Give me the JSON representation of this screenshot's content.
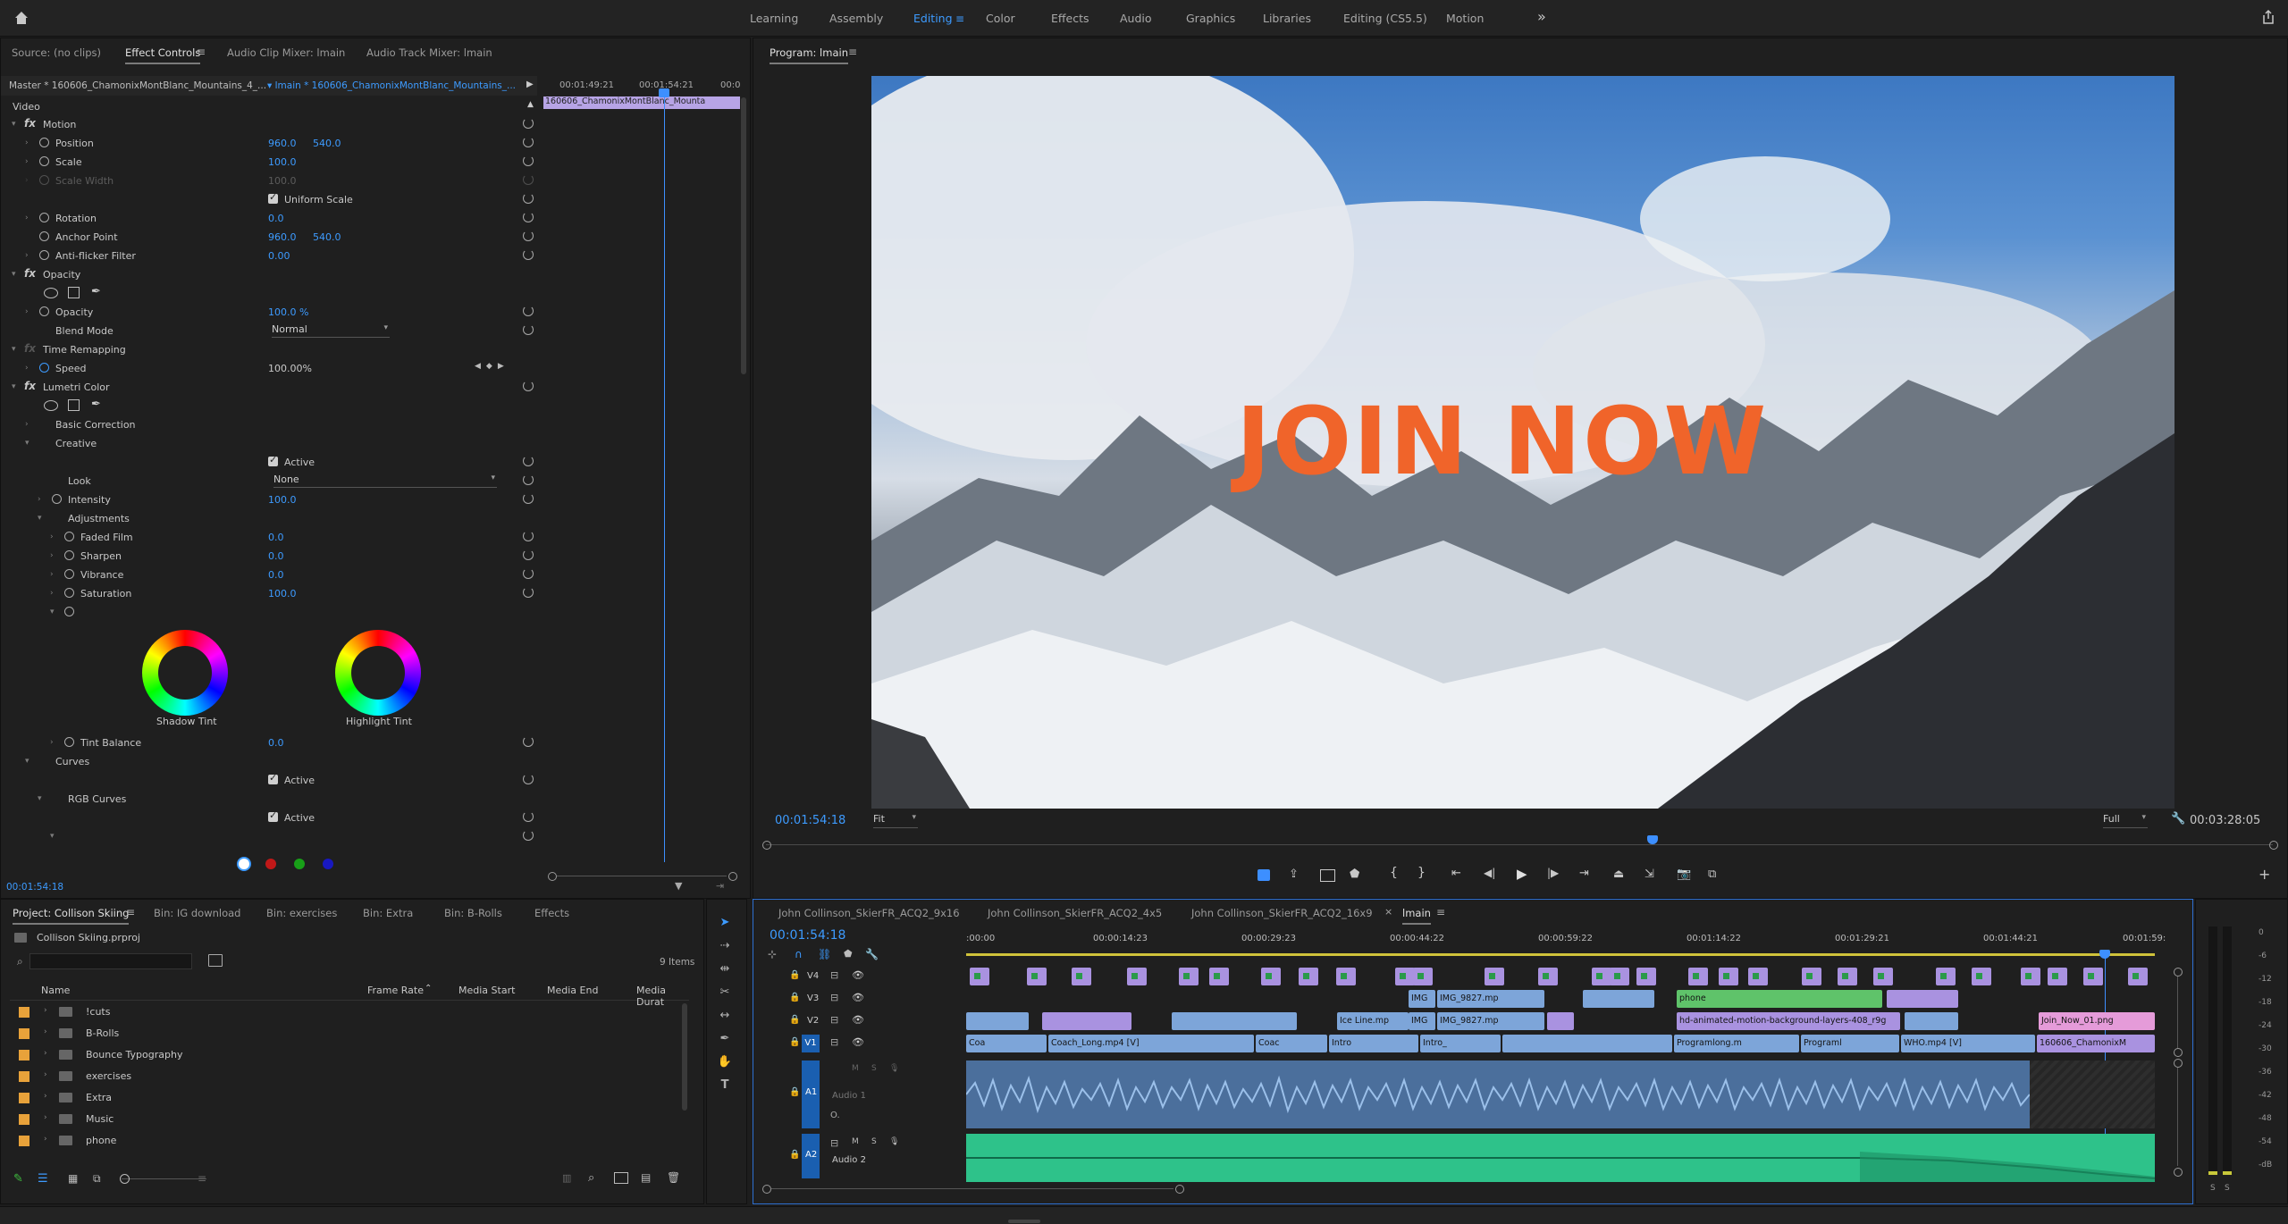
{
  "workspaces": [
    "Learning",
    "Assembly",
    "Editing",
    "Color",
    "Effects",
    "Audio",
    "Graphics",
    "Libraries",
    "Editing (CS5.5)",
    "Motion"
  ],
  "active_workspace": "Editing",
  "source_tabs": {
    "source": "Source: (no clips)",
    "effect_controls": "Effect Controls",
    "audio_clip_mixer": "Audio Clip Mixer: lmain",
    "audio_track_mixer": "Audio Track Mixer: lmain"
  },
  "effect_controls": {
    "master_clip": "Master * 160606_ChamonixMontBlanc_Mountains_4_...",
    "sequence_clip": "lmain * 160606_ChamonixMontBlanc_Mountains_...",
    "timecode_left": "00:01:49:21",
    "timecode_mid": "00:01:54:21",
    "timecode_right": "00:0",
    "clip_name": "160606_ChamonixMontBlanc_Mounta",
    "section_video": "Video",
    "current_time": "00:01:54:18",
    "rows": {
      "motion": "Motion",
      "position": "Position",
      "position_x": "960.0",
      "position_y": "540.0",
      "scale": "Scale",
      "scale_v": "100.0",
      "scale_width": "Scale Width",
      "scale_width_v": "100.0",
      "uniform_scale": "Uniform Scale",
      "rotation": "Rotation",
      "rotation_v": "0.0",
      "anchor": "Anchor Point",
      "anchor_x": "960.0",
      "anchor_y": "540.0",
      "antiflicker": "Anti-flicker Filter",
      "antiflicker_v": "0.00",
      "opacity_group": "Opacity",
      "opacity": "Opacity",
      "opacity_v": "100.0 %",
      "blend": "Blend Mode",
      "blend_v": "Normal",
      "time_remap": "Time Remapping",
      "speed": "Speed",
      "speed_v": "100.00%",
      "lumetri": "Lumetri Color",
      "basic": "Basic Correction",
      "creative": "Creative",
      "active": "Active",
      "look": "Look",
      "look_v": "None",
      "intensity": "Intensity",
      "intensity_v": "100.0",
      "adjustments": "Adjustments",
      "faded": "Faded Film",
      "faded_v": "0.0",
      "sharpen": "Sharpen",
      "sharpen_v": "0.0",
      "vibrance": "Vibrance",
      "vibrance_v": "0.0",
      "saturation": "Saturation",
      "saturation_v": "100.0",
      "shadow_tint": "Shadow Tint",
      "highlight_tint": "Highlight Tint",
      "tint_balance": "Tint Balance",
      "tint_balance_v": "0.0",
      "curves": "Curves",
      "rgb_curves": "RGB Curves"
    }
  },
  "program": {
    "title": "Program: lmain",
    "overlay_text": "JOIN NOW",
    "timecode": "00:01:54:18",
    "fit": "Fit",
    "quality": "Full",
    "duration": "00:03:28:05"
  },
  "project": {
    "tabs": [
      "Project: Collison Skiing",
      "Bin: IG download",
      "Bin: exercises",
      "Bin: Extra",
      "Bin: B-Rolls",
      "Effects"
    ],
    "file": "Collison Skiing.prproj",
    "items_count": "9 Items",
    "columns": [
      "Name",
      "Frame Rate",
      "Media Start",
      "Media End",
      "Media Durat"
    ],
    "items": [
      "!cuts",
      "B-Rolls",
      "Bounce Typography",
      "exercises",
      "Extra",
      "Music",
      "phone"
    ]
  },
  "timeline": {
    "tabs": [
      "John Collinson_SkierFR_ACQ2_9x16",
      "John Collinson_SkierFR_ACQ2_4x5",
      "John Collinson_SkierFR_ACQ2_16x9",
      "lmain"
    ],
    "timecode": "00:01:54:18",
    "ruler": [
      ":00:00",
      "00:00:14:23",
      "00:00:29:23",
      "00:00:44:22",
      "00:00:59:22",
      "00:01:14:22",
      "00:01:29:21",
      "00:01:44:21",
      "00:01:59:"
    ],
    "tracks": [
      "V4",
      "V3",
      "V2",
      "V1",
      "A1",
      "A2"
    ],
    "audio1_name": "Audio 1",
    "audio2_name": "Audio 2",
    "clips": {
      "img1": "IMG",
      "img2": "IMG_9827.mp",
      "phone": "phone",
      "img3": "IMG",
      "img4": "IMG_9827.mp",
      "iceline": "Ice Line.mp",
      "hd": "hd-animated-motion-background-layers-408_r9g",
      "joinnow": "Join_Now_01.png",
      "coa": "Coa",
      "coach": "Coach_Long.mp4 [V]",
      "coac": "Coac",
      "intro": "Intro",
      "intro2": "Intro_",
      "programlong": "Programlong.m",
      "programl": "Programl",
      "who": "WHO.mp4 [V]",
      "chamonix": "160606_ChamonixM"
    }
  },
  "meter_labels": [
    "0",
    "-6",
    "-12",
    "-18",
    "-24",
    "-30",
    "-36",
    "-42",
    "-48",
    "-54",
    "-dB"
  ],
  "meter_solo": [
    "S",
    "S"
  ]
}
